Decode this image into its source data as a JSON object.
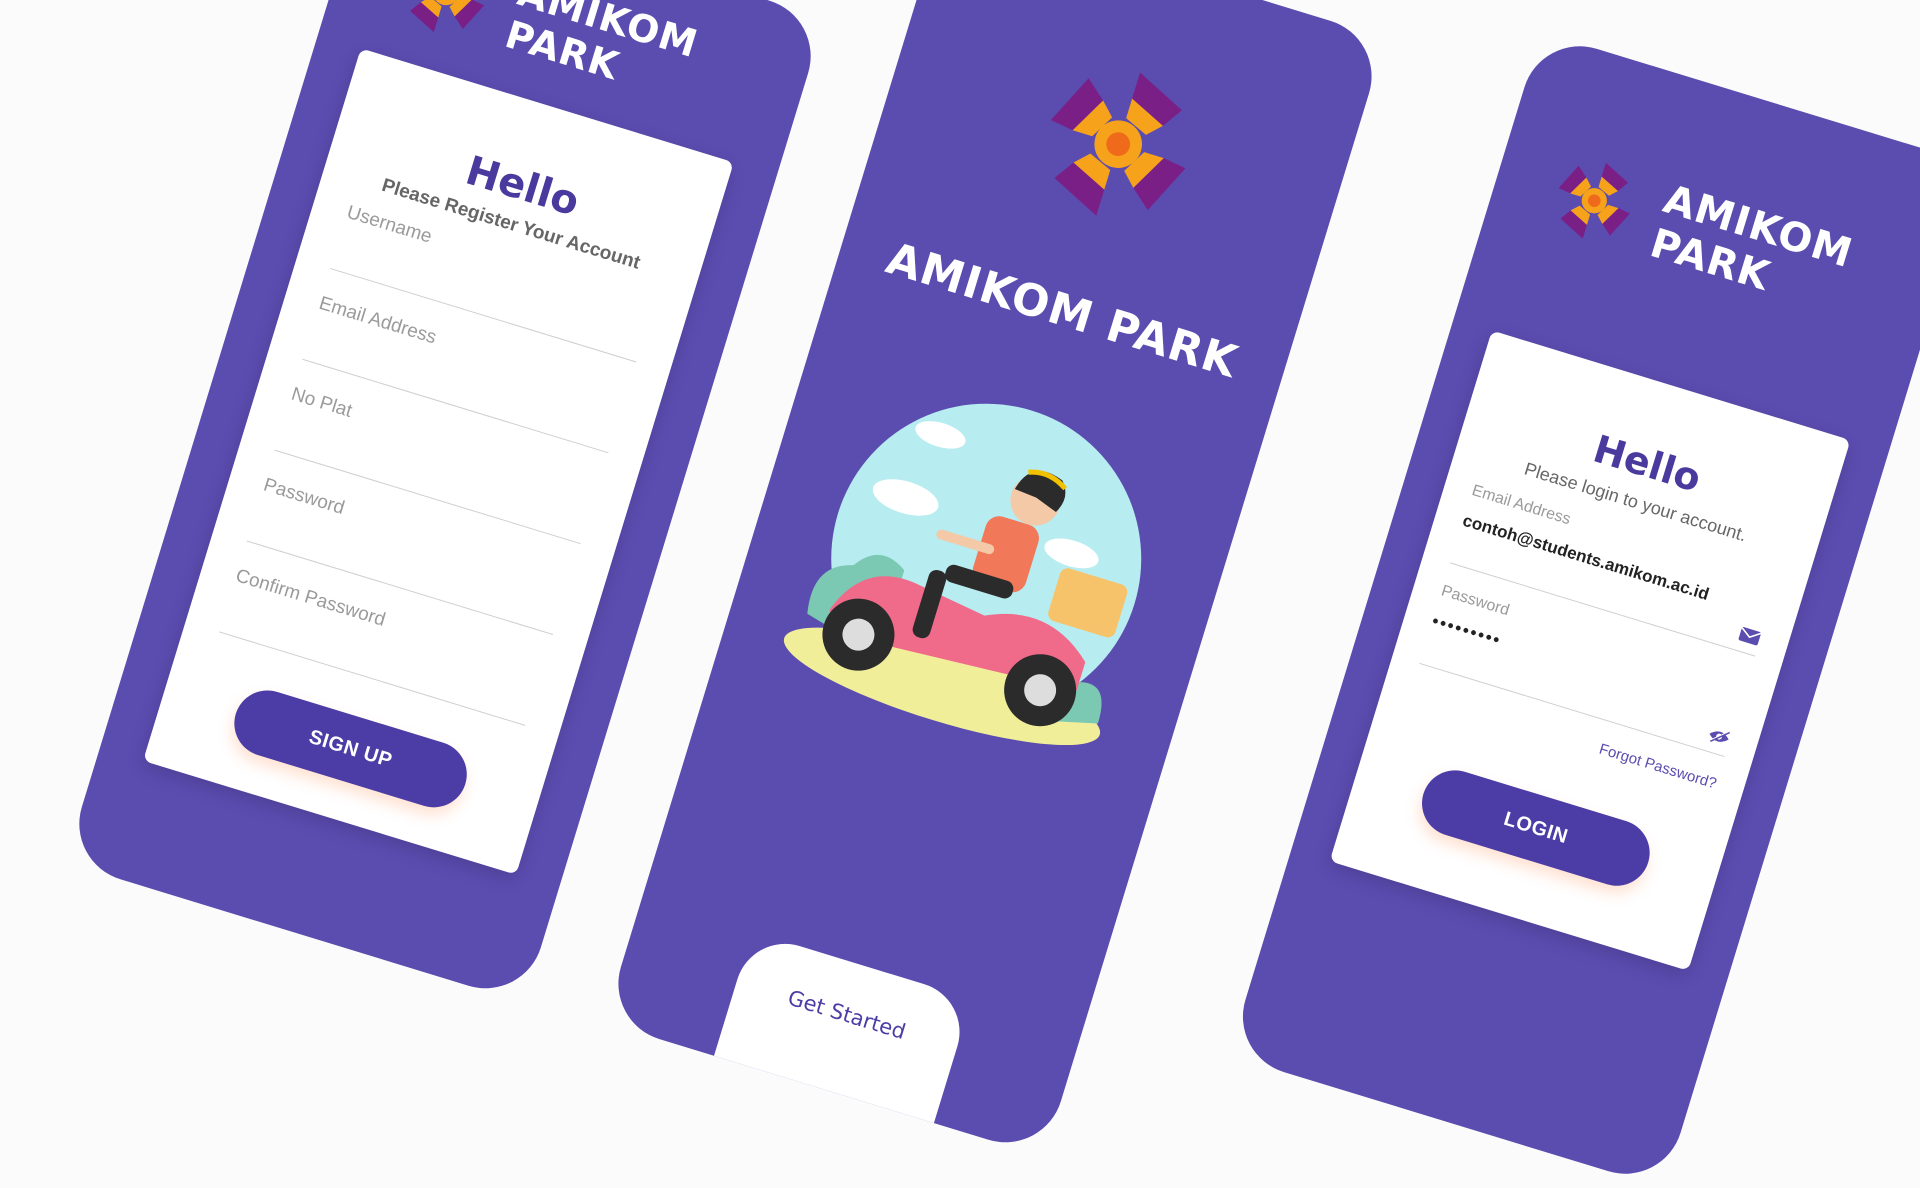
{
  "brand": {
    "name": "AMIKOM PARK",
    "name_line1": "AMIKOM",
    "name_line2": "PARK",
    "colors": {
      "primary": "#5b4cb0",
      "button": "#4b3ca6",
      "logo_purple": "#7a1f86",
      "logo_orange": "#f7a21b"
    }
  },
  "register": {
    "hello": "Hello",
    "subtitle": "Please Register Your Account",
    "fields": [
      {
        "label": "Username"
      },
      {
        "label": "Email Address"
      },
      {
        "label": "No Plat"
      },
      {
        "label": "Password"
      },
      {
        "label": "Confirm Password"
      }
    ],
    "button_label": "SIGN UP"
  },
  "splash": {
    "title": "AMIKOM PARK",
    "get_started_label": "Get Started",
    "illustration": "scooter-rider-illustration"
  },
  "login": {
    "hello": "Hello",
    "subtitle": "Please login to your account.",
    "email_label": "Email Address",
    "email_value": "contoh@students.amikom.ac.id",
    "email_icon": "mail-icon",
    "password_label": "Password",
    "password_value": "•••••••••",
    "password_icon": "eye-off-icon",
    "forgot_label": "Forgot Password?",
    "button_label": "LOGIN"
  }
}
